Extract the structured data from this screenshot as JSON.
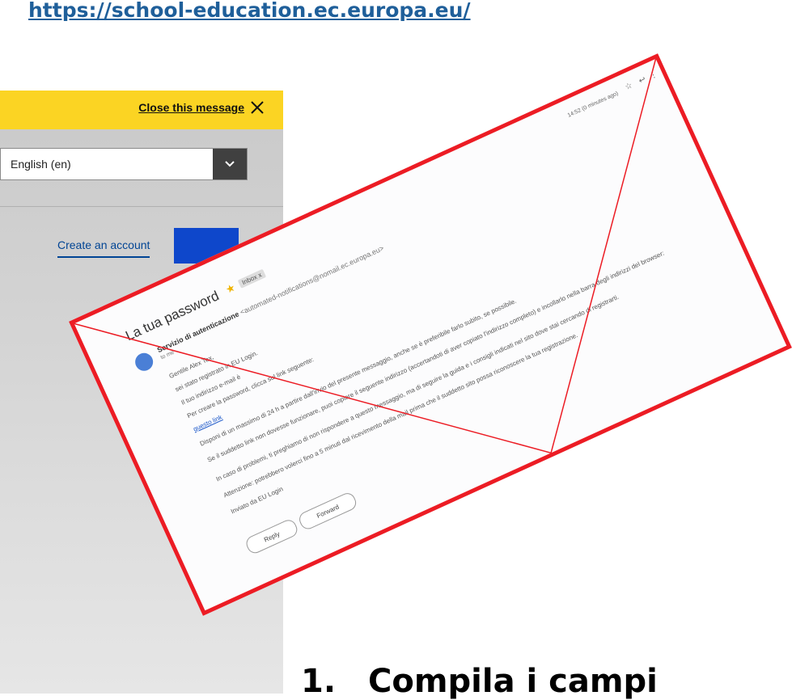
{
  "slide": {
    "url": "https://school-education.ec.europa.eu/",
    "heading_number": "1.",
    "heading_text": "Compila i campi"
  },
  "eu_login": {
    "banner_color": "#fbd423",
    "close_message": "Close this message",
    "language": "English (en)",
    "create_account": "Create an account"
  },
  "email": {
    "subject": "La tua password",
    "inbox_label": "Inbox x",
    "sender": "Servizio di autenticazione",
    "sender_address": "<automated-notifications@nomail.ec.europa.eu>",
    "to_me": "to me",
    "date": "14:52 (0 minutes ago)",
    "greeting": "Gentile Alex Tex,",
    "line_registered": "sei stato registrato in EU Login.",
    "line_email": "Il tuo indirizzo e-mail è",
    "line_create": "Per creare la password, clicca sul link seguente:",
    "link_text": "questo link",
    "line_time": "Disponi di un massimo di 24 h a partire dall'invio del presente messaggio, anche se è preferibile farlo subito, se possibile.",
    "line_copy": "Se il suddetto link non dovesse funzionare, puoi copiare il seguente indirizzo (accertandoti di aver copiato l'indirizzo completo) e incollarlo nella barra degli indirizzi del browser:",
    "line_problems": "In caso di problemi, ti preghiamo di non rispondere a questo messaggio, ma di seguire la guida e i consigli indicati nel sito dove stai cercando di registrarti.",
    "line_attention": "Attenzione: potrebbero volerci fino a 5 minuti dal ricevimento della mail prima che il suddetto sito possa riconoscere la tua registrazione.",
    "signature": "Inviato da EU Login",
    "reply": "Reply",
    "forward": "Forward"
  },
  "colors": {
    "url": "#1f5f9a",
    "frame": "#ec1c24",
    "link": "#004494"
  }
}
